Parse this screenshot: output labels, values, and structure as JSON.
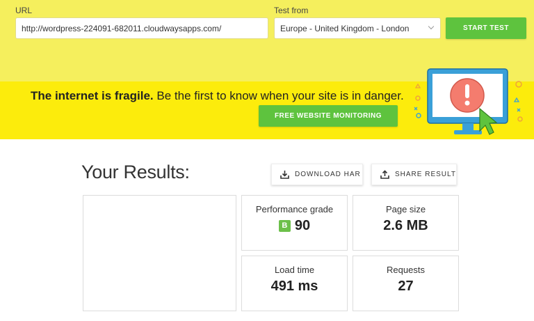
{
  "form": {
    "url_label": "URL",
    "url_value": "http://wordpress-224091-682011.cloudwaysapps.com/",
    "test_from_label": "Test from",
    "test_from_value": "Europe - United Kingdom - London",
    "start_test_label": "START TEST"
  },
  "banner": {
    "headline_bold": "The internet is fragile.",
    "headline_rest": " Be the first to know when your site is in danger.",
    "cta_label": "FREE WEBSITE MONITORING"
  },
  "results": {
    "title": "Your Results:",
    "download_har_label": "DOWNLOAD HAR",
    "share_result_label": "SHARE RESULT",
    "metrics": {
      "performance_grade": {
        "label": "Performance grade",
        "grade": "B",
        "value": "90"
      },
      "page_size": {
        "label": "Page size",
        "value": "2.6 MB"
      },
      "load_time": {
        "label": "Load time",
        "value": "491 ms"
      },
      "requests": {
        "label": "Requests",
        "value": "27"
      }
    }
  },
  "colors": {
    "top_bg": "#f5ef5d",
    "banner_bg": "#fcec0c",
    "green": "#5ec33e",
    "grade_green": "#6cc04a"
  },
  "icons": [
    "chevron-down-icon",
    "download-icon",
    "share-icon",
    "monitor-alert-illustration"
  ]
}
